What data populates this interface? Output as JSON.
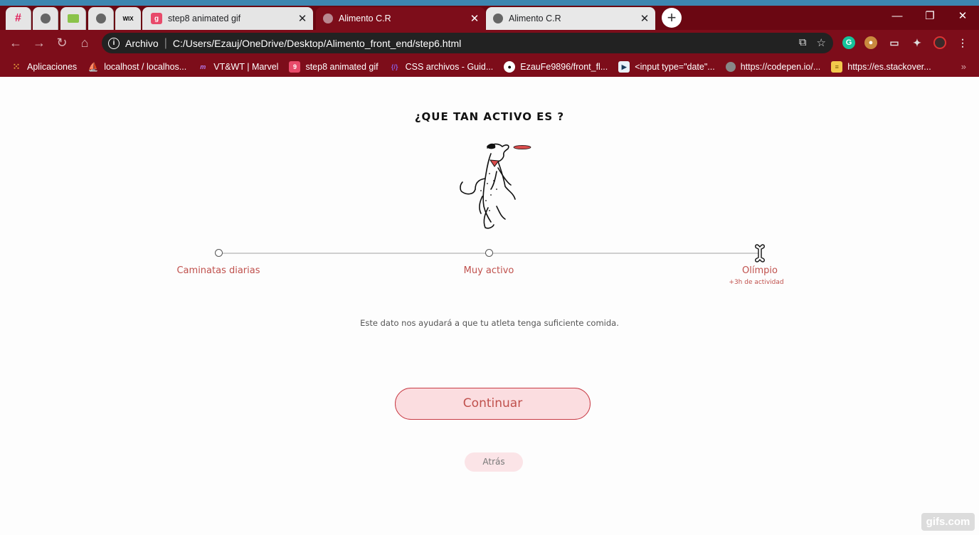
{
  "browser": {
    "tabs": [
      {
        "title": "step8 animated gif",
        "favicon": "giphy-icon",
        "favicon_text": "g"
      },
      {
        "title": "Alimento C.R",
        "favicon": "globe-icon"
      },
      {
        "title": "Alimento C.R",
        "favicon": "globe-icon"
      }
    ],
    "pinned_tabs": [
      "slack-icon",
      "globe-icon",
      "wolfram-icon",
      "globe-icon",
      "wix-icon"
    ],
    "omnibox": {
      "scheme_label": "Archivo",
      "url": "C:/Users/Ezauj/OneDrive/Desktop/Alimento_front_end/step6.html"
    },
    "bookmarks": [
      {
        "label": "Aplicaciones",
        "icon": "apps-grid-icon"
      },
      {
        "label": "localhost / localhos...",
        "icon": "phpmyadmin-icon"
      },
      {
        "label": "VT&WT | Marvel",
        "icon": "marvel-icon"
      },
      {
        "label": "step8 animated gif",
        "icon": "giphy-icon"
      },
      {
        "label": "CSS archivos - Guid...",
        "icon": "css-icon"
      },
      {
        "label": "EzauFe9896/front_fl...",
        "icon": "github-icon"
      },
      {
        "label": "<input type=\"date\"...",
        "icon": "mdn-icon"
      },
      {
        "label": "https://codepen.io/...",
        "icon": "globe-icon"
      },
      {
        "label": "https://es.stackover...",
        "icon": "stackoverflow-icon"
      }
    ],
    "accent": "#7d0d1a"
  },
  "page": {
    "heading": "¿QUE TAN ACTIVO ES ?",
    "levels": [
      {
        "label": "Caminatas diarias",
        "sub": ""
      },
      {
        "label": "Muy activo",
        "sub": ""
      },
      {
        "label": "Olímpio",
        "sub": "+3h de actividad"
      }
    ],
    "selected_level": "Olímpio",
    "helper_text": "Este dato nos ayudará a que tu atleta tenga suficiente comida.",
    "continue_label": "Continuar",
    "back_label": "Atrás",
    "accent": "#c0514d"
  },
  "watermark": "gifs.com"
}
